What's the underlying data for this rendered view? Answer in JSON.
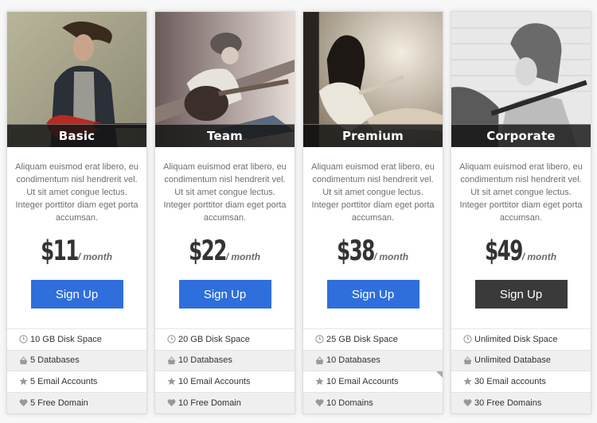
{
  "accent_colors": {
    "primary_button": "#2f6fdb",
    "featured_button": "#3a3a3a"
  },
  "plans": [
    {
      "name": "Basic",
      "description": "Aliquam euismod erat libero, eu condimentum nisl hendrerit vel. Ut sit amet congue lectus. Integer porttitor diam eget porta accumsan.",
      "price": "$11",
      "period": "/ month",
      "button_label": "Sign Up",
      "button_style": "blue",
      "features": [
        {
          "icon": "clock-icon",
          "label": "10 GB Disk Space"
        },
        {
          "icon": "basket-icon",
          "label": "5 Databases"
        },
        {
          "icon": "star-icon",
          "label": "5 Email Accounts"
        },
        {
          "icon": "heart-icon",
          "label": "5 Free Domain"
        }
      ]
    },
    {
      "name": "Team",
      "description": "Aliquam euismod erat libero, eu condimentum nisl hendrerit vel. Ut sit amet congue lectus. Integer porttitor diam eget porta accumsan.",
      "price": "$22",
      "period": "/ month",
      "button_label": "Sign Up",
      "button_style": "blue",
      "features": [
        {
          "icon": "clock-icon",
          "label": "20 GB Disk Space"
        },
        {
          "icon": "basket-icon",
          "label": "10 Databases"
        },
        {
          "icon": "star-icon",
          "label": "10 Email Accounts"
        },
        {
          "icon": "heart-icon",
          "label": "10 Free Domain"
        }
      ]
    },
    {
      "name": "Premium",
      "description": "Aliquam euismod erat libero, eu condimentum nisl hendrerit vel. Ut sit amet congue lectus. Integer porttitor diam eget porta accumsan.",
      "price": "$38",
      "period": "/ month",
      "button_label": "Sign Up",
      "button_style": "blue",
      "features": [
        {
          "icon": "clock-icon",
          "label": "25 GB Disk Space"
        },
        {
          "icon": "basket-icon",
          "label": "10 Databases"
        },
        {
          "icon": "star-icon",
          "label": "10 Email Accounts"
        },
        {
          "icon": "heart-icon",
          "label": "10 Domains"
        }
      ]
    },
    {
      "name": "Corporate",
      "description": "Aliquam euismod erat libero, eu condimentum nisl hendrerit vel. Ut sit amet congue lectus. Integer porttitor diam eget porta accumsan.",
      "price": "$49",
      "period": "/ month",
      "button_label": "Sign Up",
      "button_style": "dark",
      "features": [
        {
          "icon": "clock-icon",
          "label": "Unlimited Disk Space"
        },
        {
          "icon": "basket-icon",
          "label": "Unlimited Database"
        },
        {
          "icon": "star-icon",
          "label": "30 Email accounts"
        },
        {
          "icon": "heart-icon",
          "label": "30 Free Domains"
        }
      ]
    }
  ]
}
